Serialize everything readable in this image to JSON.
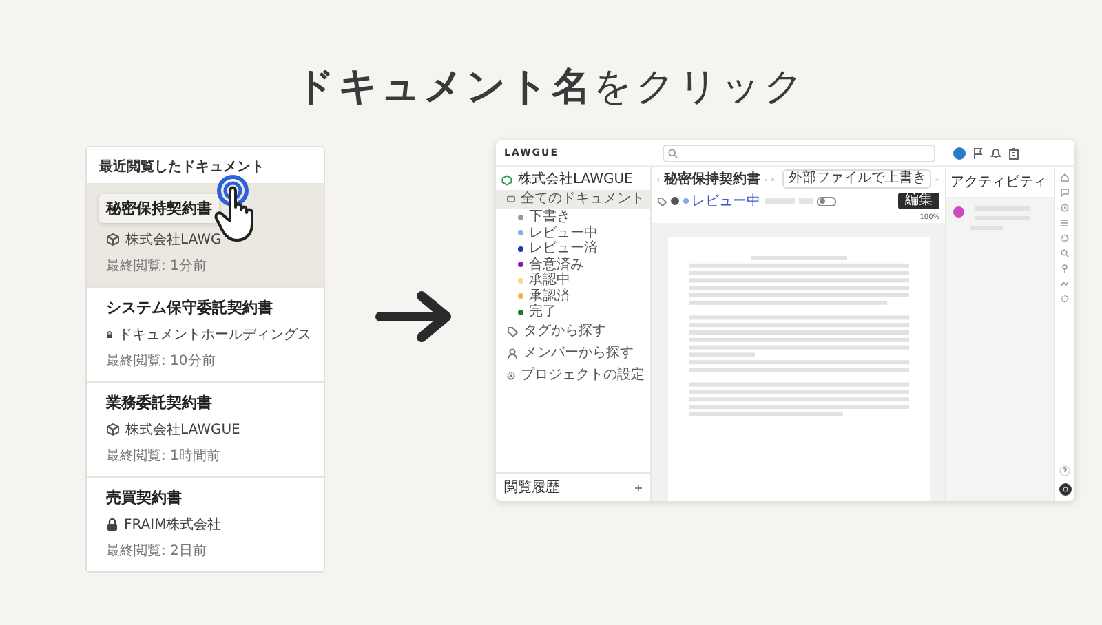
{
  "headline": "**ドキュメント名**をクリック",
  "recent": {
    "title": "最近閲覧したドキュメント",
    "items": [
      {
        "name": "秘密保持契約書",
        "org": "株式会社LAWG",
        "kind": "company",
        "viewed": "最終閲覧: 1分前",
        "selected": true
      },
      {
        "name": "システム保守委託契約書",
        "org": "ドキュメントホールディングス",
        "kind": "locked",
        "viewed": "最終閲覧: 10分前",
        "selected": false
      },
      {
        "name": "業務委託契約書",
        "org": "株式会社LAWGUE",
        "kind": "company",
        "viewed": "最終閲覧: 1時間前",
        "selected": false
      },
      {
        "name": "売買契約書",
        "org": "FRAIM株式会社",
        "kind": "locked",
        "viewed": "最終閲覧: 2日前",
        "selected": false
      }
    ]
  },
  "app": {
    "logo": "LAWGUE",
    "sidebar": {
      "org": "株式会社LAWGUE",
      "all": {
        "label": "全てのドキュメント",
        "selected": true
      },
      "statuses": [
        {
          "label": "下書き",
          "color": "#9a9a9a"
        },
        {
          "label": "レビュー中",
          "color": "#8fa6e8"
        },
        {
          "label": "レビュー済",
          "color": "#1a3fa8"
        },
        {
          "label": "合意済み",
          "color": "#8a1fb5"
        },
        {
          "label": "承認中",
          "color": "#f3d98a"
        },
        {
          "label": "承認済",
          "color": "#f0b43c"
        },
        {
          "label": "完了",
          "color": "#1e7a32"
        }
      ],
      "links": [
        {
          "kind": "tag",
          "label": "タグから探す"
        },
        {
          "kind": "member",
          "label": "メンバーから探す"
        },
        {
          "kind": "settings",
          "label": "プロジェクトの設定"
        }
      ],
      "history": "閲覧履歴"
    },
    "document": {
      "title": "秘密保持契約書",
      "overwrite": "外部ファイルで上書き",
      "status": "レビュー中",
      "edit": "編集",
      "zoom": "100%",
      "toggle_on": false
    },
    "activity": {
      "title": "アクティビティ"
    }
  }
}
